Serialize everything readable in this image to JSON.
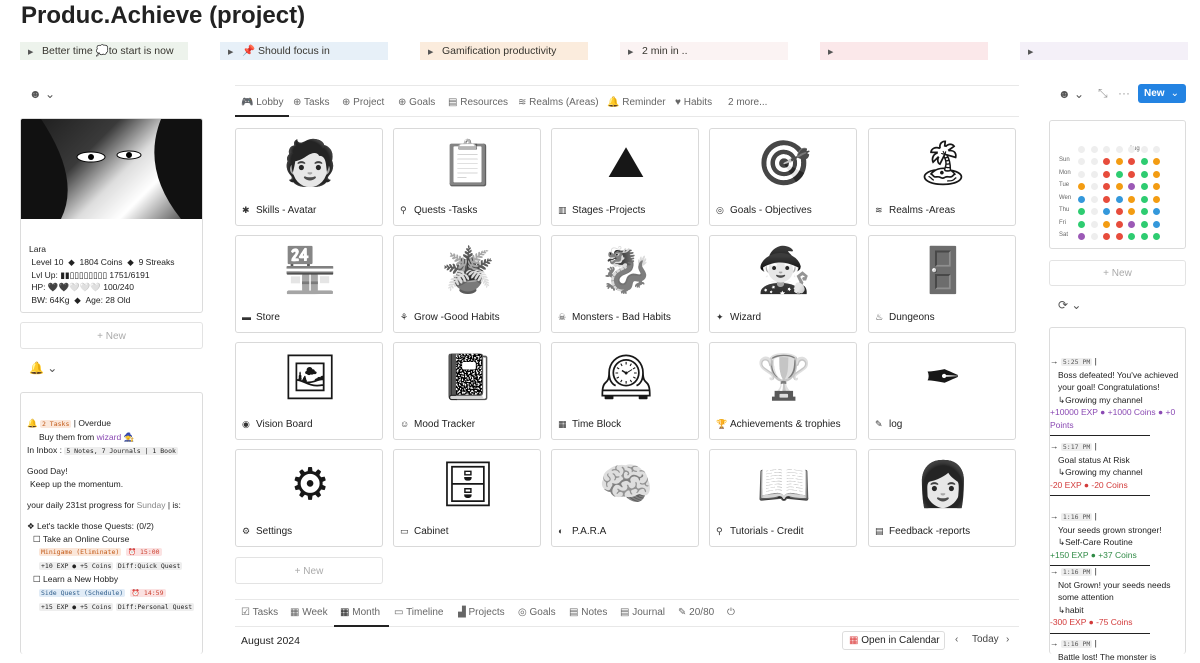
{
  "title": "Produc.Achieve (project)",
  "toggles": [
    "Better time 💭to start is now",
    "📌 Should focus in",
    "Gamification productivity",
    "2 min in ..",
    "",
    ""
  ],
  "profile": {
    "name": "Lara",
    "level": "Level 10",
    "coins": "1804 Coins",
    "streaks": "9 Streaks",
    "lvl_up_label": "Lvl Up:",
    "lvl_up_bar": "▮▮▯▯▯▯▯▯▯▯",
    "lvl_up_val": "1751/6191",
    "hp_label": "HP:",
    "hp_hearts": "🖤🖤🤍🤍🤍",
    "hp_val": "100/240",
    "bw": "BW:  64Kg",
    "age": "Age: 28 Old",
    "diamond": "◆"
  },
  "new_label": "New",
  "status": {
    "warn": "🔔",
    "tasks_tag": "2 Tasks",
    "overdue": "| Overdue",
    "buy": "Buy them from",
    "wizard": "wizard",
    "wizard_emoji": "🧙",
    "inbox_label": "In Inbox :",
    "inbox_tag": "5 Notes, 7 Journals | 1 Book",
    "greet": "Good Day!",
    "keep": "Keep up the momentum.",
    "daily": "your daily 231st progress for",
    "day": "Sunday",
    "is": "| is:",
    "quests_head": "❖ Let's tackle those Quests: (0/2)",
    "quests": [
      {
        "name": "Take an Online Course",
        "tag1": "Minigame (Eliminate)",
        "time": "⏰ 15:00",
        "reward": "+10 EXP ● +5 Coins",
        "diff": "Diff:Quick Quest"
      },
      {
        "name": "Learn a New Hobby",
        "tag1": "Side Quest (Schedule)",
        "time": "⏰ 14:59",
        "reward": "+15 EXP ● +5 Coins",
        "diff": "Diff:Personal Quest"
      }
    ]
  },
  "tabs": [
    {
      "icon": "🎮",
      "label": "Lobby"
    },
    {
      "icon": "⊕",
      "label": "Tasks"
    },
    {
      "icon": "⊕",
      "label": "Project"
    },
    {
      "icon": "⊕",
      "label": "Goals"
    },
    {
      "icon": "▤",
      "label": "Resources"
    },
    {
      "icon": "≋",
      "label": "Realms (Areas)"
    },
    {
      "icon": "🔔",
      "label": "Reminder"
    },
    {
      "icon": "♥",
      "label": "Habits"
    },
    {
      "icon": "",
      "label": "2 more..."
    }
  ],
  "tiles": [
    {
      "icon": "✱",
      "label": "Skills - Avatar",
      "art": "🧑"
    },
    {
      "icon": "⚲",
      "label": "Quests -Tasks",
      "art": "📋"
    },
    {
      "icon": "▥",
      "label": "Stages -Projects",
      "art": "⛰"
    },
    {
      "icon": "◎",
      "label": "Goals - Objectives",
      "art": "🎯"
    },
    {
      "icon": "≋",
      "label": "Realms -Areas",
      "art": "🏝"
    },
    {
      "icon": "▬",
      "label": "Store",
      "art": "🏪"
    },
    {
      "icon": "⚘",
      "label": "Grow -Good Habits",
      "art": "🪴"
    },
    {
      "icon": "☠",
      "label": "Monsters - Bad Habits",
      "art": "🐉"
    },
    {
      "icon": "✦",
      "label": "Wizard",
      "art": "🧙"
    },
    {
      "icon": "♨",
      "label": "Dungeons",
      "art": "🚪"
    },
    {
      "icon": "◉",
      "label": "Vision Board",
      "art": "🖼"
    },
    {
      "icon": "☺",
      "label": "Mood Tracker",
      "art": "📓"
    },
    {
      "icon": "▦",
      "label": "Time Block",
      "art": "🕰"
    },
    {
      "icon": "🏆",
      "label": "Achievements & trophies",
      "art": "🏆"
    },
    {
      "icon": "✎",
      "label": "log",
      "art": "✒"
    },
    {
      "icon": "⚙",
      "label": "Settings",
      "art": "⚙"
    },
    {
      "icon": "▭",
      "label": "Cabinet",
      "art": "🗄"
    },
    {
      "icon": "◐",
      "label": "P.A.R.A",
      "art": "🧠"
    },
    {
      "icon": "⚲",
      "label": "Tutorials - Credit",
      "art": "📖"
    },
    {
      "icon": "▤",
      "label": "Feedback -reports",
      "art": "👩"
    }
  ],
  "bottom_tabs": [
    {
      "icon": "☑",
      "label": "Tasks"
    },
    {
      "icon": "▦",
      "label": "Week"
    },
    {
      "icon": "▦",
      "label": "Month"
    },
    {
      "icon": "▭",
      "label": "Timeline"
    },
    {
      "icon": "▟",
      "label": "Projects"
    },
    {
      "icon": "◎",
      "label": "Goals"
    },
    {
      "icon": "▤",
      "label": "Notes"
    },
    {
      "icon": "▤",
      "label": "Journal"
    },
    {
      "icon": "✎",
      "label": "20/80"
    },
    {
      "icon": "⏻",
      "label": ""
    }
  ],
  "calendar": {
    "month": "August 2024",
    "open": "Open in Calendar",
    "today": "Today"
  },
  "topright": {
    "new": "New"
  },
  "habit_grid": {
    "month": "Aug",
    "days": [
      "Sun",
      "Mon",
      "Tue",
      "Wen",
      "Thu",
      "Fri",
      "Sat"
    ]
  },
  "feed": [
    {
      "time": "5:25 PM",
      "lines": [
        "Boss defeated! You've achieved your goal! Congratulations!"
      ],
      "project": "↳Growing my channel",
      "reward": "+10000 EXP ● +1000 Coins ● +0 Points",
      "color": "purple"
    },
    {
      "time": "5:17 PM",
      "lines": [
        "Goal status At Risk"
      ],
      "project": "↳Growing my channel",
      "reward": "-20 EXP ● -20 Coins",
      "color": "red"
    },
    {
      "time": "1:16 PM",
      "lines": [
        "Your seeds grown stronger!"
      ],
      "project": "↳Self-Care Routine",
      "reward": "+150 EXP ● +37 Coins",
      "color": "green"
    },
    {
      "time": "1:16 PM",
      "lines": [
        "Not Grown! your seeds needs some attention"
      ],
      "project": "↳habit",
      "reward": "-300 EXP ● -75 Coins",
      "color": "red"
    },
    {
      "time": "1:16 PM",
      "lines": [
        "Battle lost! The monster is"
      ],
      "project": "",
      "reward": "",
      "color": ""
    }
  ]
}
